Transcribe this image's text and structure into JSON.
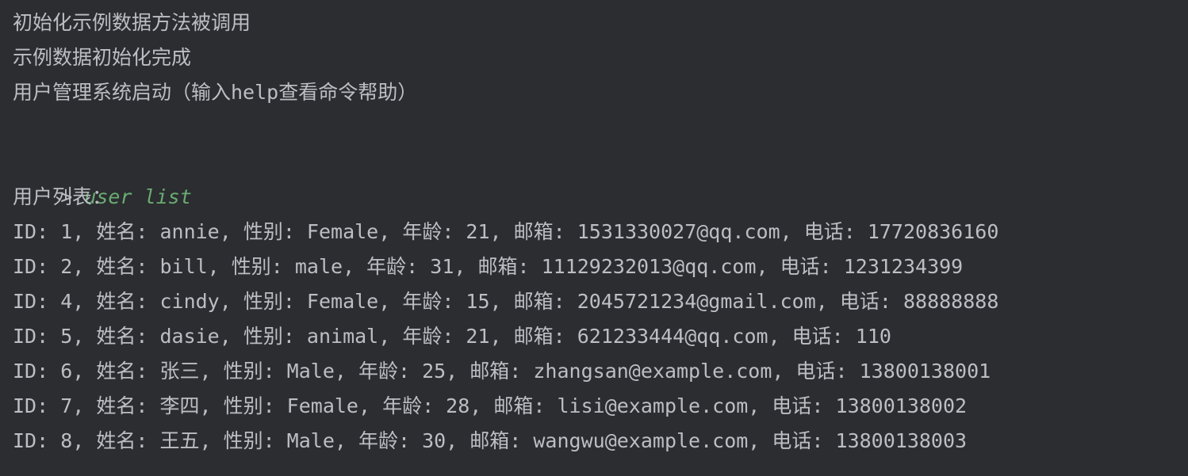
{
  "console": {
    "lines_before": [
      "初始化示例数据方法被调用",
      "示例数据初始化完成",
      "用户管理系统启动（输入help查看命令帮助）",
      ""
    ],
    "prompt_symbol": "> ",
    "command": "user list",
    "lines_after": [
      "用户列表：",
      "ID: 1, 姓名: annie, 性别: Female, 年龄: 21, 邮箱: 1531330027@qq.com, 电话: 17720836160",
      "ID: 2, 姓名: bill, 性别: male, 年龄: 31, 邮箱: 11129232013@qq.com, 电话: 1231234399",
      "ID: 4, 姓名: cindy, 性别: Female, 年龄: 15, 邮箱: 2045721234@gmail.com, 电话: 88888888",
      "ID: 5, 姓名: dasie, 性别: animal, 年龄: 21, 邮箱: 621233444@qq.com, 电话: 110",
      "ID: 6, 姓名: 张三, 性别: Male, 年龄: 25, 邮箱: zhangsan@example.com, 电话: 13800138001",
      "ID: 7, 姓名: 李四, 性别: Female, 年龄: 28, 邮箱: lisi@example.com, 电话: 13800138002",
      "ID: 8, 姓名: 王五, 性别: Male, 年龄: 30, 邮箱: wangwu@example.com, 电话: 13800138003"
    ]
  },
  "colors": {
    "background": "#2b2d30",
    "text": "#bcbec4",
    "command": "#6aab73"
  }
}
